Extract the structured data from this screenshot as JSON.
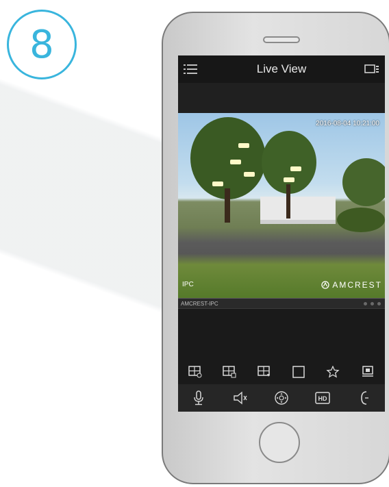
{
  "step": {
    "number": "8"
  },
  "app": {
    "title": "Live View",
    "menu_icon": "menu-list-icon",
    "device_icon": "device-list-icon"
  },
  "video": {
    "timestamp": "2016-08-04 10:21:00",
    "channel_label": "IPC",
    "brand_label": "AMCREST"
  },
  "device_bar": {
    "name": "AMCREST-IPC"
  },
  "toolbar_top": {
    "items": [
      "split-1-icon",
      "split-4-icon",
      "split-9-icon",
      "single-view-icon",
      "favorite-icon",
      "record-icon"
    ]
  },
  "toolbar_bottom": {
    "items": [
      "microphone-icon",
      "speaker-icon",
      "ptz-icon",
      "hd-icon",
      "more-icon"
    ],
    "hd_label": "HD"
  },
  "colors": {
    "accent": "#39b5dd",
    "screen_bg": "#1a1a1a",
    "icon": "#d9d9d9"
  }
}
